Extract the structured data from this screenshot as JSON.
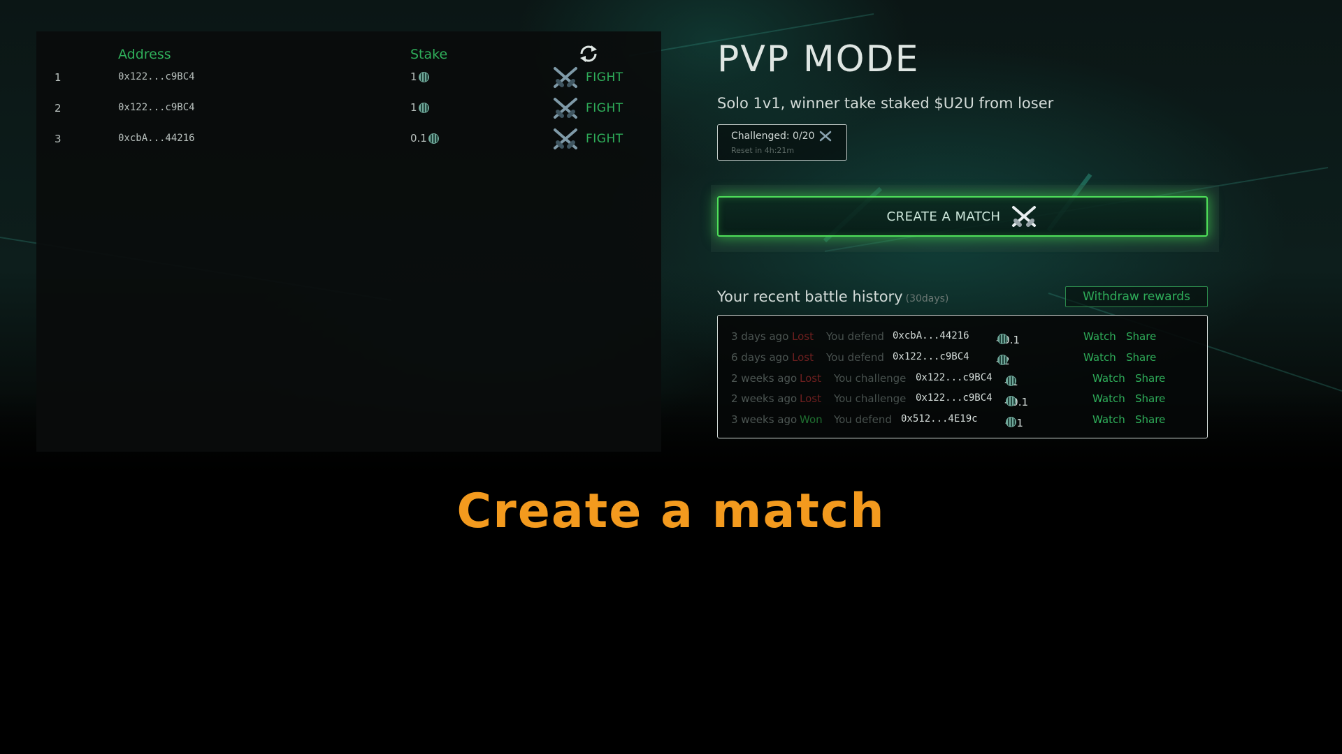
{
  "lobby": {
    "headers": {
      "address": "Address",
      "stake": "Stake"
    },
    "refresh_icon": "refresh-icon",
    "rows": [
      {
        "index": "1",
        "address": "0x122...c9BC4",
        "stake": "1",
        "action": "FIGHT"
      },
      {
        "index": "2",
        "address": "0x122...c9BC4",
        "stake": "1",
        "action": "FIGHT"
      },
      {
        "index": "3",
        "address": "0xcbA...44216",
        "stake": "0.1",
        "action": "FIGHT"
      }
    ]
  },
  "pvp": {
    "title": "PVP MODE",
    "subtitle": "Solo 1v1, winner take staked $U2U from loser",
    "challenged": "Challenged: 0/20",
    "reset": "Reset in 4h:21m",
    "create_button": "CREATE A MATCH"
  },
  "history": {
    "title": "Your recent battle history",
    "period": "(30days)",
    "withdraw_button": "Withdraw rewards",
    "rows": [
      {
        "ago": "3 days ago",
        "result": "Lost",
        "role": "You defend",
        "opponent": "0xcbA...44216",
        "amount": "- 0.1",
        "watch": "Watch",
        "share": "Share"
      },
      {
        "ago": "6 days ago",
        "result": "Lost",
        "role": "You defend",
        "opponent": "0x122...c9BC4",
        "amount": "- 2",
        "watch": "Watch",
        "share": "Share"
      },
      {
        "ago": "2 weeks ago",
        "result": "Lost",
        "role": "You challenge",
        "opponent": "0x122...c9BC4",
        "amount": "- 1",
        "watch": "Watch",
        "share": "Share"
      },
      {
        "ago": "2 weeks ago",
        "result": "Lost",
        "role": "You challenge",
        "opponent": "0x122...c9BC4",
        "amount": "- 0.1",
        "watch": "Watch",
        "share": "Share"
      },
      {
        "ago": "3 weeks ago",
        "result": "Won",
        "role": "You defend",
        "opponent": "0x512...4E19c",
        "amount": "+ 1",
        "watch": "Watch",
        "share": "Share"
      }
    ]
  },
  "caption": "Create a match",
  "colors": {
    "accent_green": "#2fae5a",
    "button_glow": "#4fe05a",
    "caption_orange": "#f39a1e",
    "lost_red": "#6e1f1f",
    "won_green": "#1f6e30"
  }
}
